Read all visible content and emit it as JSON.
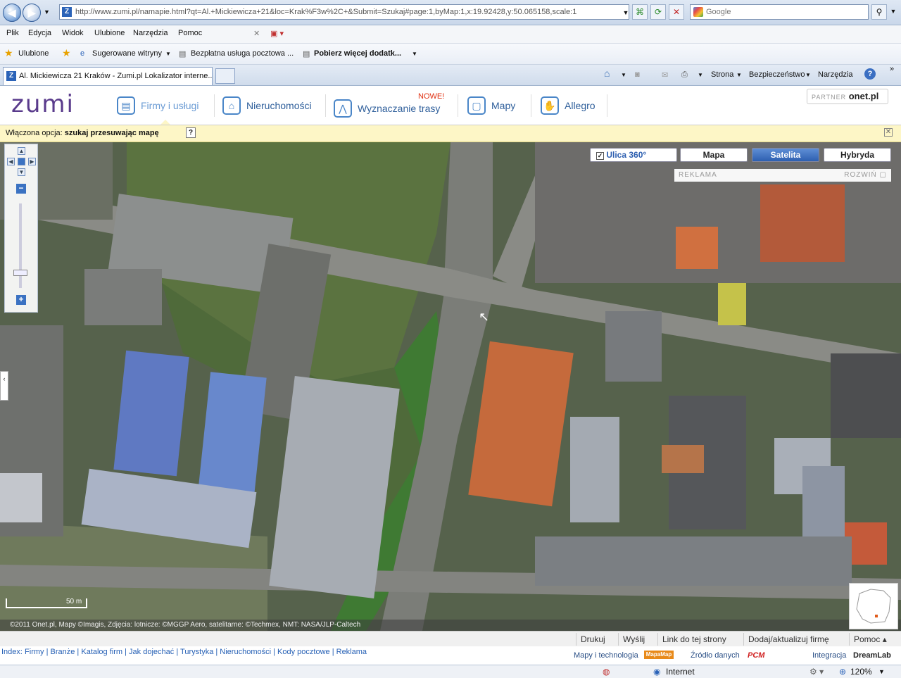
{
  "browser": {
    "url": "http://www.zumi.pl/namapie.html?qt=Al.+Mickiewicza+21&loc=Krak%F3w%2C+&Submit=Szukaj#page:1,byMap:1,x:19.92428,y:50.065158,scale:1",
    "search_placeholder": "Google",
    "menu": [
      "Plik",
      "Edycja",
      "Widok",
      "Ulubione",
      "Narzędzia",
      "Pomoc"
    ],
    "favorites": {
      "label": "Ulubione",
      "items": [
        "Sugerowane witryny",
        "Bezpłatna usługa pocztowa ...",
        "Pobierz więcej dodatk..."
      ]
    },
    "tab_title": "Al. Mickiewicza 21 Kraków - Zumi.pl Lokalizator interne...",
    "toolbar": [
      "Strona",
      "Bezpieczeństwo",
      "Narzędzia"
    ]
  },
  "site": {
    "logo": "zumi",
    "nav": [
      {
        "label": "Firmy i usługi",
        "icon": "building-icon"
      },
      {
        "label": "Nieruchomości",
        "icon": "house-icon"
      },
      {
        "label": "Wyznaczanie trasy",
        "icon": "route-icon",
        "badge": "NOWE!"
      },
      {
        "label": "Mapy",
        "icon": "map-icon"
      },
      {
        "label": "Allegro",
        "icon": "hand-icon"
      }
    ],
    "partner_prefix": "PARTNER",
    "partner_name": "onet.pl"
  },
  "option_bar": {
    "prefix": "Włączona opcja:",
    "value": "szukaj przesuwając mapę",
    "help": "?"
  },
  "map": {
    "types": [
      {
        "label": "Ulica 360°",
        "active": false,
        "checkbox": true
      },
      {
        "label": "Mapa",
        "active": false
      },
      {
        "label": "Satelita",
        "active": true
      },
      {
        "label": "Hybryda",
        "active": false
      }
    ],
    "ad_label": "REKLAMA",
    "ad_expand": "ROZWIŃ",
    "scale_label": "50 m",
    "copyright": "©2011 Onet.pl, Mapy ©Imagis, Zdjęcia: lotnicze: ©MGGP Aero, satelitarne: ©Techmex, NMT: NASA/JLP-Caltech"
  },
  "footer": {
    "buttons": [
      "Drukuj",
      "Wyślij",
      "Link do tej strony",
      "Dodaj/aktualizuj firmę",
      "Pomoc"
    ],
    "index_label": "Index:",
    "links": [
      "Firmy",
      "Branże",
      "Katalog firm",
      "Jak dojechać",
      "Turystyka",
      "Nieruchomości",
      "Kody pocztowe",
      "Reklama"
    ],
    "brands": [
      "Mapy i technologia",
      "MapaMap",
      "Źródło danych",
      "PCM",
      "Integracja",
      "DreamLab"
    ]
  },
  "status": {
    "zone": "Internet",
    "zoom": "120%"
  }
}
